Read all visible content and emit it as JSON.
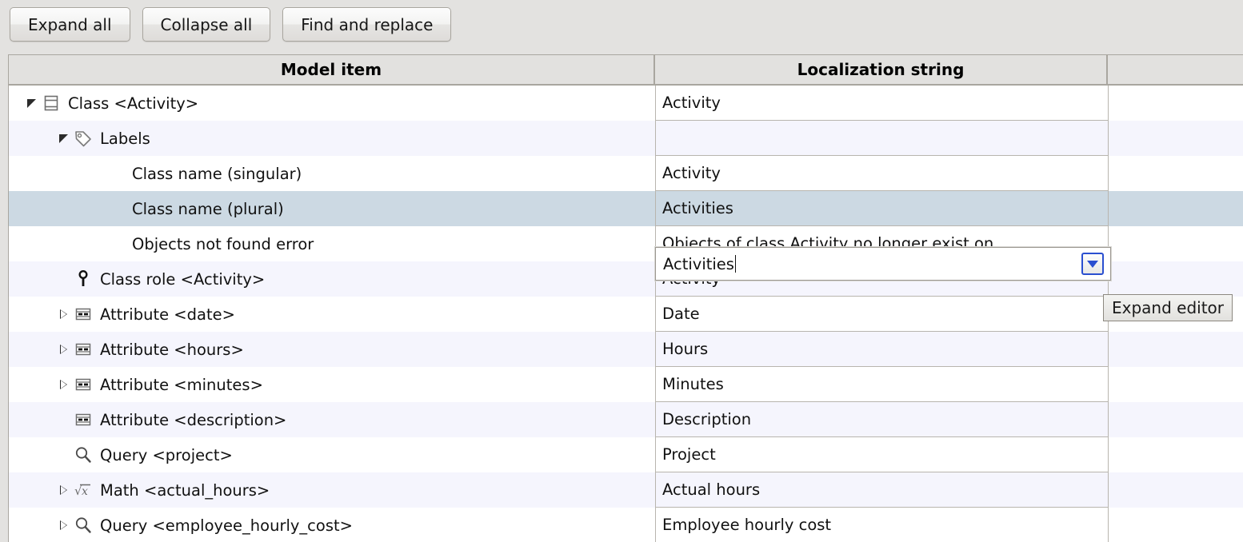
{
  "toolbar": {
    "buttons": [
      {
        "label": "Expand all",
        "name": "expand-all-button"
      },
      {
        "label": "Collapse all",
        "name": "collapse-all-button"
      },
      {
        "label": "Find and replace",
        "name": "find-and-replace-button"
      }
    ]
  },
  "table": {
    "columns": [
      {
        "header": "Model item"
      },
      {
        "header": "Localization string"
      },
      {
        "header": ""
      }
    ],
    "rows": [
      {
        "indent": 0,
        "twisty": "expanded",
        "icon": "class-icon",
        "item": "Class <Activity>",
        "loc": "Activity",
        "band": "white"
      },
      {
        "indent": 1,
        "twisty": "expanded",
        "icon": "tag-icon",
        "item": "Labels",
        "loc": "",
        "band": "alt"
      },
      {
        "indent": 2,
        "twisty": "none",
        "icon": "none",
        "item": "Class name (singular)",
        "loc": "Activity",
        "band": "white"
      },
      {
        "indent": 2,
        "twisty": "none",
        "icon": "none",
        "item": "Class name (plural)",
        "loc": "Activities",
        "band": "selected"
      },
      {
        "indent": 2,
        "twisty": "none",
        "icon": "none",
        "item": "Objects not found error",
        "loc": "Objects of class Activity no longer exist on",
        "band": "white"
      },
      {
        "indent": 1,
        "twisty": "none",
        "icon": "class-role-icon",
        "item": "Class role <Activity>",
        "loc": "Activity",
        "band": "alt"
      },
      {
        "indent": 1,
        "twisty": "collapsed",
        "icon": "attribute-icon",
        "item": "Attribute <date>",
        "loc": "Date",
        "band": "white"
      },
      {
        "indent": 1,
        "twisty": "collapsed",
        "icon": "attribute-icon",
        "item": "Attribute <hours>",
        "loc": "Hours",
        "band": "alt"
      },
      {
        "indent": 1,
        "twisty": "collapsed",
        "icon": "attribute-icon",
        "item": "Attribute <minutes>",
        "loc": "Minutes",
        "band": "white"
      },
      {
        "indent": 1,
        "twisty": "none",
        "icon": "attribute-icon",
        "item": "Attribute <description>",
        "loc": "Description",
        "band": "alt"
      },
      {
        "indent": 1,
        "twisty": "none",
        "icon": "query-icon",
        "item": "Query <project>",
        "loc": "Project",
        "band": "white"
      },
      {
        "indent": 1,
        "twisty": "collapsed",
        "icon": "math-icon",
        "item": "Math <actual_hours>",
        "loc": "Actual hours",
        "band": "alt"
      },
      {
        "indent": 1,
        "twisty": "collapsed",
        "icon": "query-icon",
        "item": "Query <employee_hourly_cost>",
        "loc": "Employee hourly cost",
        "band": "white"
      }
    ]
  },
  "editor": {
    "value": "Activities",
    "expand_button_icon": "chevron-down-icon"
  },
  "tooltip": {
    "text": "Expand editor"
  },
  "colors": {
    "background": "#e3e2e0",
    "header": "#e2e1df",
    "row_white": "#ffffff",
    "row_alt": "#f5f5fd",
    "row_selected": "#ccd9e3",
    "border": "#a9a69f",
    "accent_blue": "#2a4fd0"
  }
}
